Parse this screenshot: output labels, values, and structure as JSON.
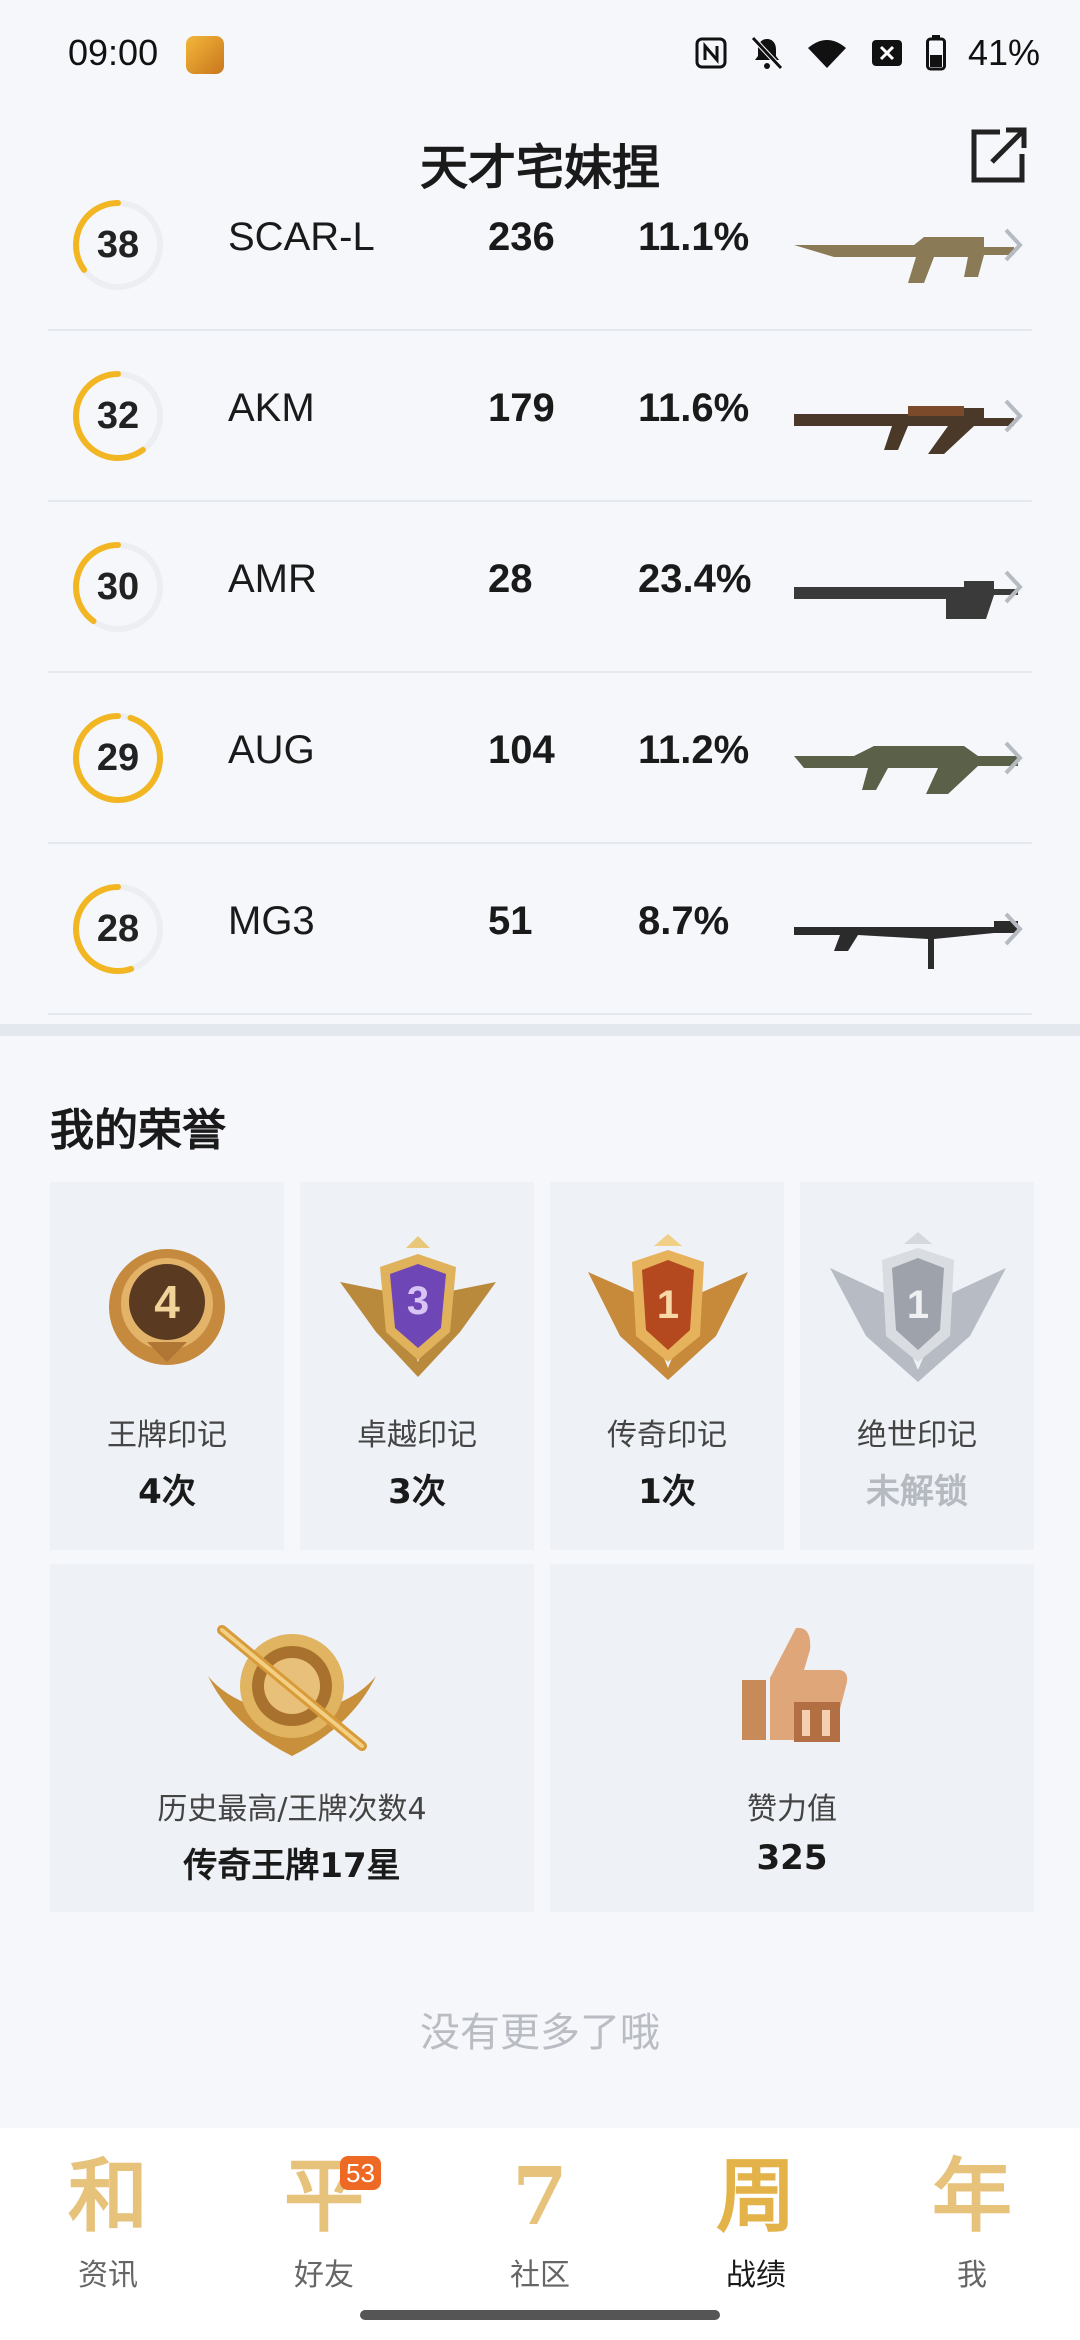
{
  "status_bar": {
    "time": "09:00",
    "battery": "41%",
    "icons": [
      "nfc-icon",
      "bell-off-icon",
      "wifi-icon",
      "no-sim-icon",
      "battery-icon"
    ]
  },
  "header": {
    "title": "天才宅妹捏",
    "share_icon": "share-icon"
  },
  "weapons": [
    {
      "level": "38",
      "name": "SCAR-L",
      "kills": "236",
      "rate": "11.1%",
      "progress": 0.35,
      "ring_color": "#f2b623"
    },
    {
      "level": "32",
      "name": "AKM",
      "kills": "179",
      "rate": "11.6%",
      "progress": 0.6,
      "ring_color": "#f2b623"
    },
    {
      "level": "30",
      "name": "AMR",
      "kills": "28",
      "rate": "23.4%",
      "progress": 0.4,
      "ring_color": "#f2b623"
    },
    {
      "level": "29",
      "name": "AUG",
      "kills": "104",
      "rate": "11.2%",
      "progress": 0.95,
      "ring_color": "#f2b623"
    },
    {
      "level": "28",
      "name": "MG3",
      "kills": "51",
      "rate": "8.7%",
      "progress": 0.55,
      "ring_color": "#f2b623"
    }
  ],
  "honors": {
    "title": "我的荣誉",
    "badges": [
      {
        "label": "王牌印记",
        "value": "4次",
        "badge_number": "4",
        "locked": false
      },
      {
        "label": "卓越印记",
        "value": "3次",
        "badge_number": "3",
        "locked": false
      },
      {
        "label": "传奇印记",
        "value": "1次",
        "badge_number": "1",
        "locked": false
      },
      {
        "label": "绝世印记",
        "value": "未解锁",
        "badge_number": "1",
        "locked": true
      }
    ],
    "rank": {
      "label": "历史最高/王牌次数4",
      "value": "传奇王牌17星"
    },
    "likes": {
      "label": "赞力值",
      "value": "325"
    }
  },
  "footer_text": "没有更多了哦",
  "bottom_nav": {
    "items": [
      {
        "glyph": "和",
        "label": "资讯",
        "active": false
      },
      {
        "glyph": "平",
        "label": "好友",
        "active": false,
        "badge": "53"
      },
      {
        "glyph": "7",
        "label": "社区",
        "active": false
      },
      {
        "glyph": "周",
        "label": "战绩",
        "active": true
      },
      {
        "glyph": "年",
        "label": "我",
        "active": false
      }
    ]
  },
  "colors": {
    "accent_gold": "#f2b623",
    "badge_orange": "#ee6a24"
  }
}
